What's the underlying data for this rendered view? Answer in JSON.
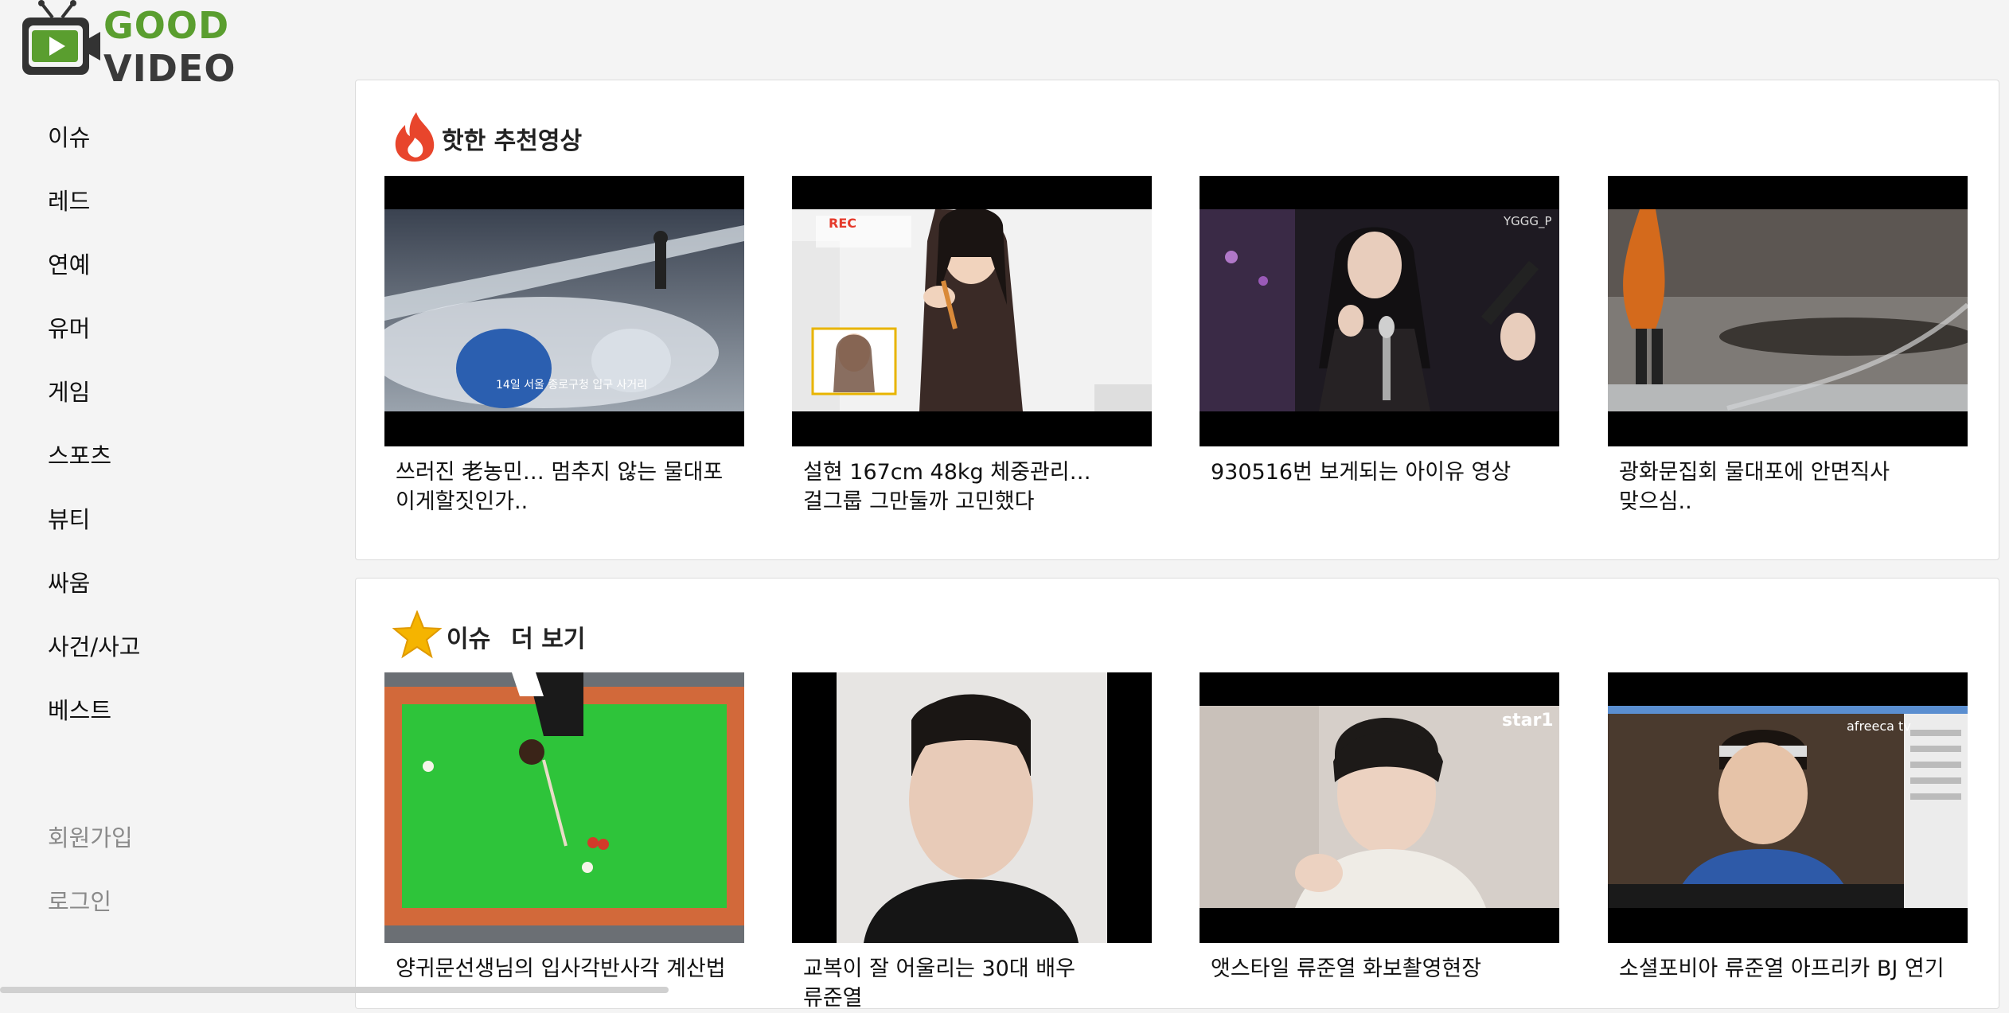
{
  "logo": {
    "good": "GOOD",
    "video": "VIDEO"
  },
  "sidebar": {
    "items": [
      {
        "label": "이슈"
      },
      {
        "label": "레드"
      },
      {
        "label": "연예"
      },
      {
        "label": "유머"
      },
      {
        "label": "게임"
      },
      {
        "label": "스포츠"
      },
      {
        "label": "뷰티"
      },
      {
        "label": "싸움"
      },
      {
        "label": "사건/사고"
      },
      {
        "label": "베스트"
      }
    ],
    "signup": "회원가입",
    "login": "로그인"
  },
  "hot": {
    "title": "핫한 추천영상",
    "icon": "fire-icon",
    "cards": [
      {
        "caption": "쓰러진 老농민… 멈추지 않는 물대포 이게할짓인가..",
        "overlay": "14일 서울 종로구청 입구 사거리"
      },
      {
        "caption": "설현 167cm 48kg 체중관리… 걸그룹 그만둘까 고민했다",
        "overlay": "REC"
      },
      {
        "caption": "930516번 보게되는 아이유 영상",
        "overlay": "YGGG_P"
      },
      {
        "caption": "광화문집회 물대포에 안면직사 맞으심..",
        "overlay": ""
      }
    ]
  },
  "issue": {
    "title": "이슈",
    "more": "더 보기",
    "icon": "star-icon",
    "cards": [
      {
        "caption": "양귀문선생님의 입사각반사각 계산법",
        "overlay": ""
      },
      {
        "caption": "교복이 잘 어울리는 30대 배우 류준열",
        "overlay": ""
      },
      {
        "caption": "앳스타일 류준열 화보촬영현장",
        "overlay": "star1"
      },
      {
        "caption": "소셜포비아 류준열 아프리카 BJ 연기",
        "overlay": "afreeca tv"
      }
    ]
  },
  "colors": {
    "accent": "#5a9e2f",
    "fire": "#e8452c",
    "star": "#f5b400",
    "pool_felt": "#2ec43a"
  }
}
